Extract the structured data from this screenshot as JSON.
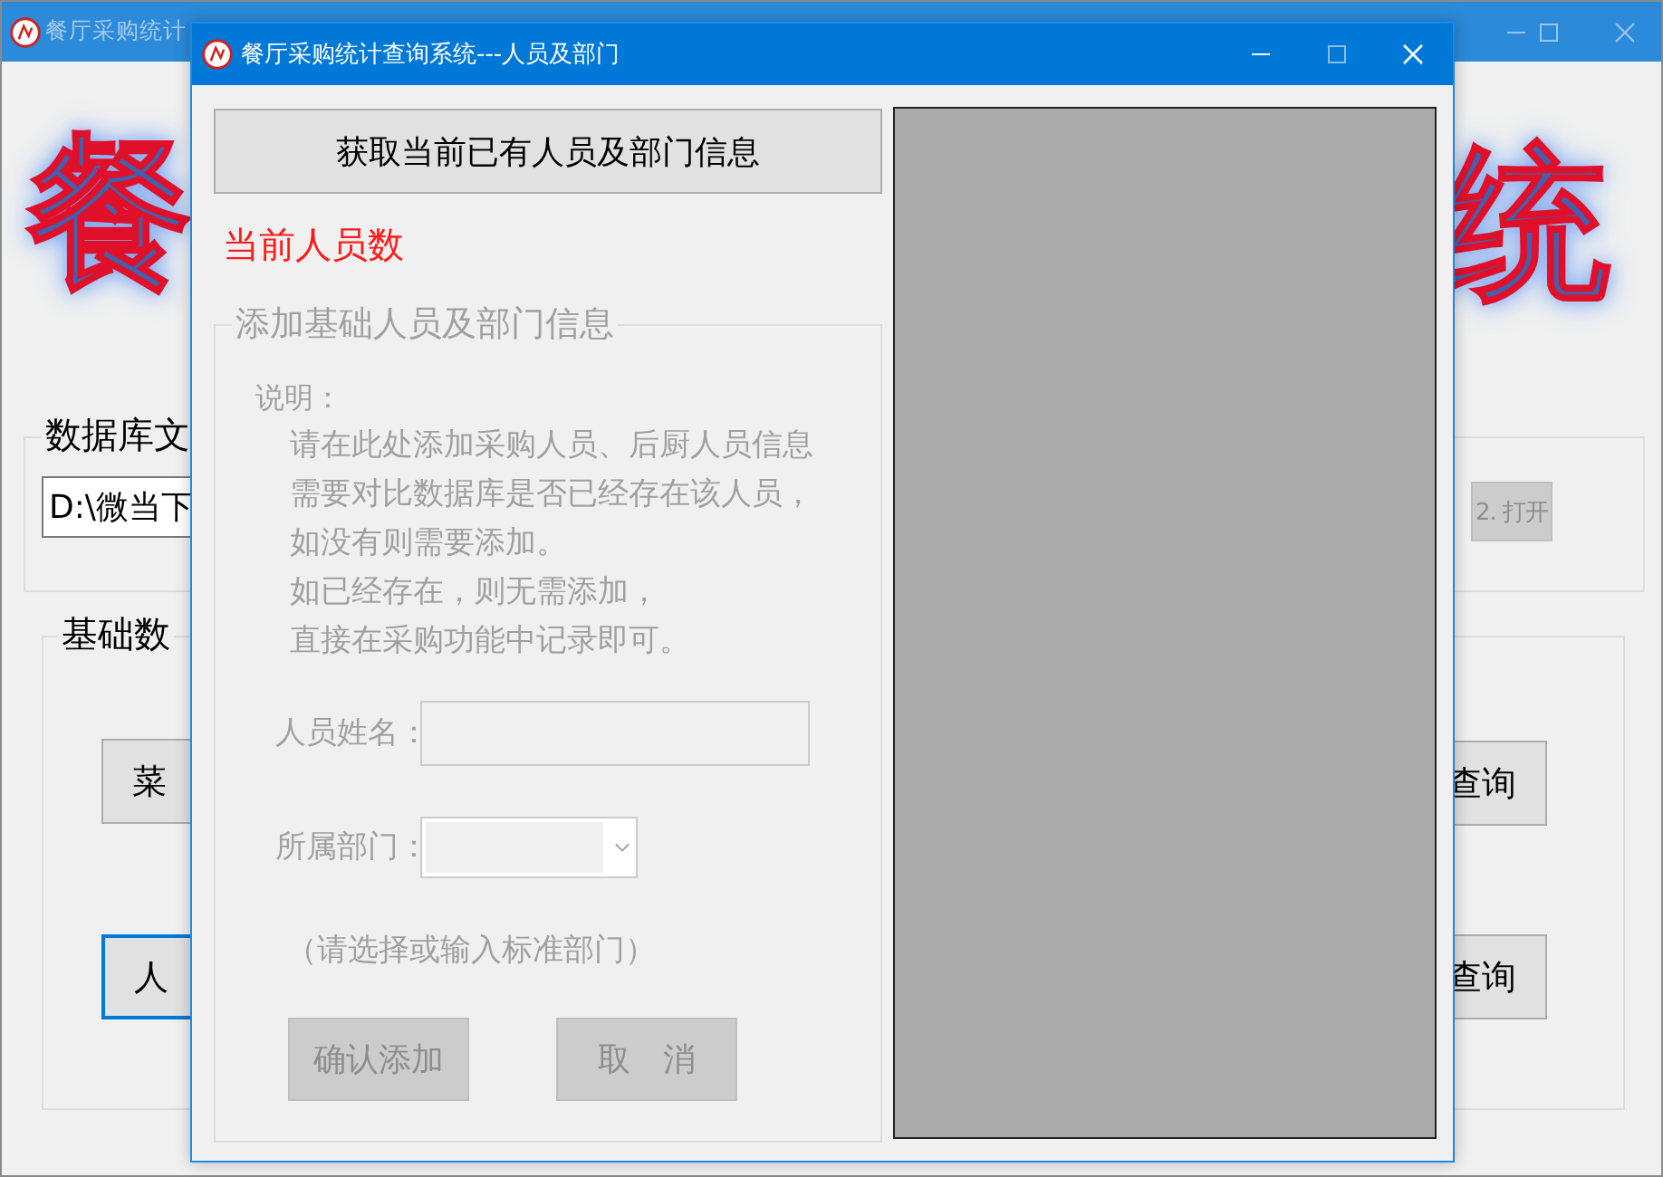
{
  "main_window": {
    "title": "餐厅采购统计",
    "active": false,
    "banner": [
      "餐",
      "统"
    ],
    "database_group": {
      "label": "数据库文",
      "path": "D:\\微当下",
      "open_button": {
        "label": "2. 打开",
        "disabled": true
      }
    },
    "basic_data_group": {
      "label": "基础数",
      "buttons": [
        {
          "label": "菜",
          "focused": false
        },
        {
          "label": "人",
          "focused": true
        },
        {
          "label": "查询",
          "focused": false
        },
        {
          "label": "查询",
          "focused": false
        }
      ]
    }
  },
  "dialog": {
    "title": "餐厅采购统计查询系统---人员及部门",
    "active": true,
    "fetch_button": "获取当前已有人员及部门信息",
    "staff_count_label": "当前人员数",
    "add_group": {
      "label": "添加基础人员及部门信息",
      "disabled": true,
      "description": {
        "heading": "说明：",
        "lines": [
          "请在此处添加采购人员、后厨人员信息",
          "需要对比数据库是否已经存在该人员，",
          "如没有则需要添加。",
          "如已经存在，则无需添加，",
          "直接在采购功能中记录即可。"
        ]
      },
      "name_field": {
        "label": "人员姓名："
      },
      "department_field": {
        "label": "所属部门："
      },
      "hint": "（请选择或输入标准部门）",
      "buttons": [
        "确认添加",
        "取　消"
      ]
    }
  }
}
